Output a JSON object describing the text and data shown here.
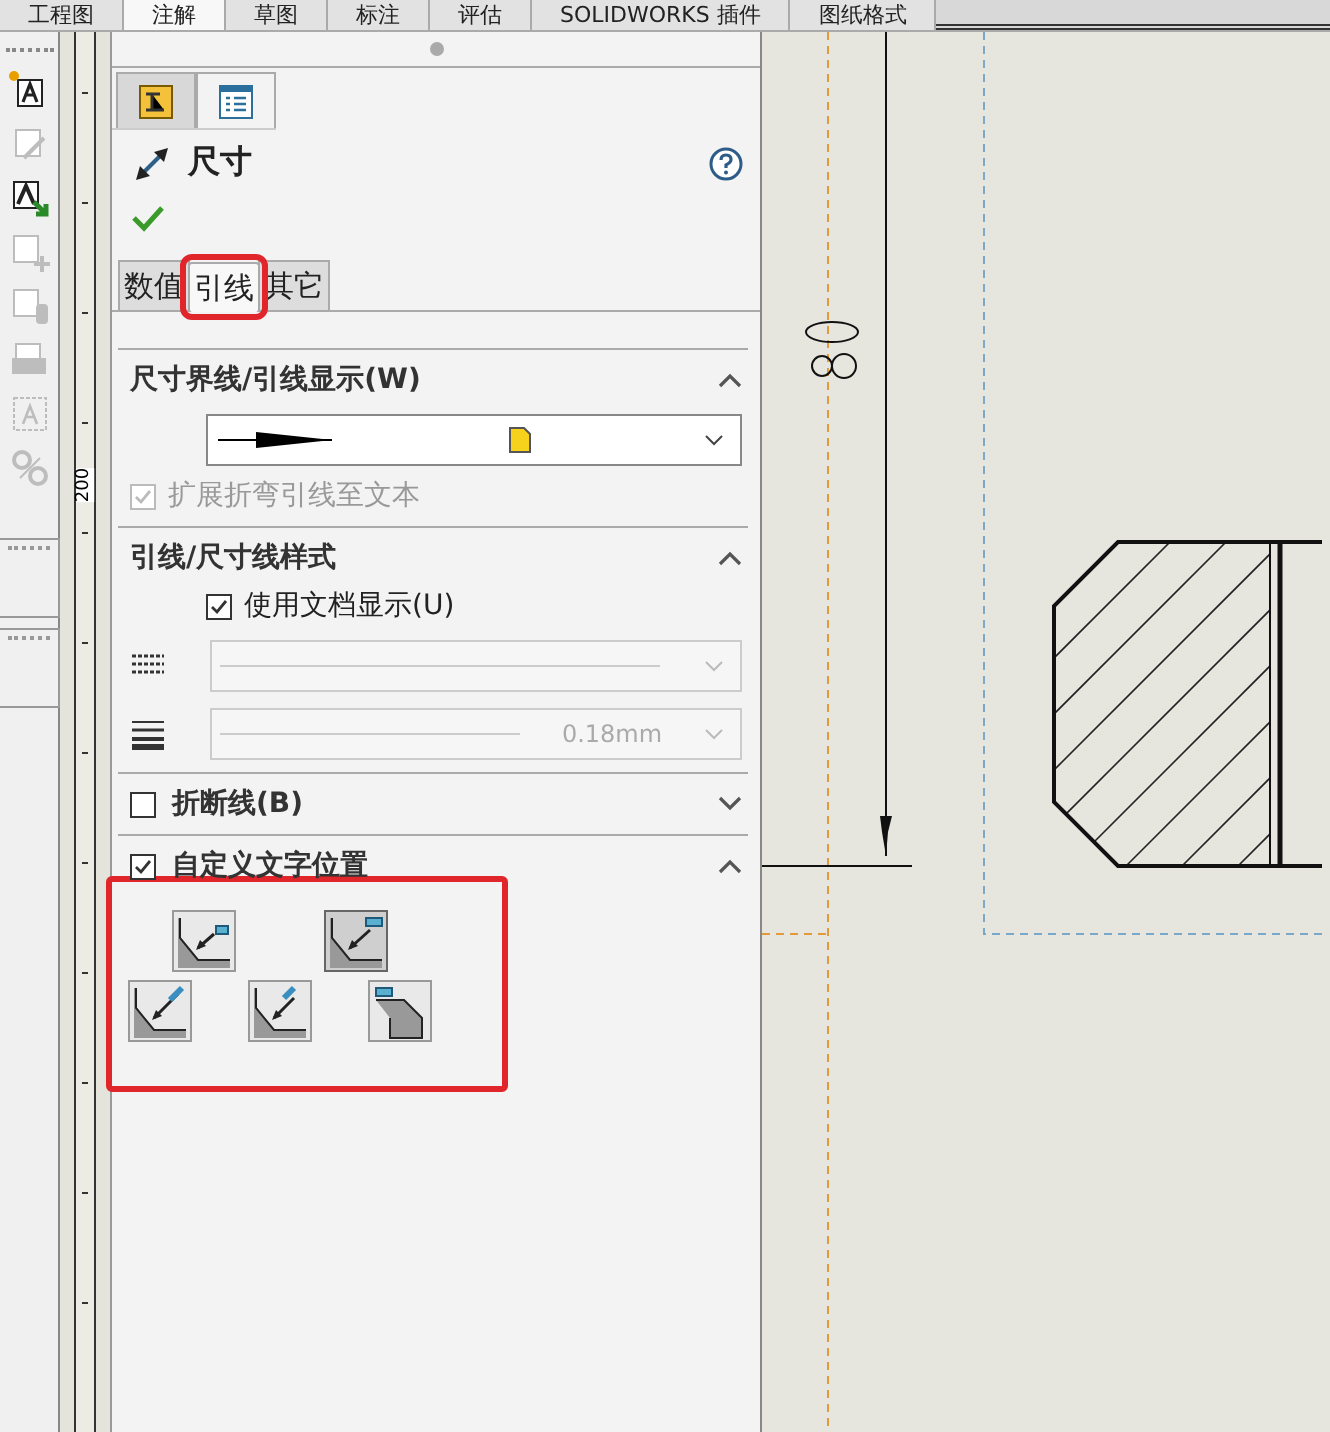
{
  "ribbon_tabs": [
    {
      "label": "工程图",
      "selected": false
    },
    {
      "label": "注解",
      "selected": true
    },
    {
      "label": "草图",
      "selected": false
    },
    {
      "label": "标注",
      "selected": false
    },
    {
      "label": "评估",
      "selected": false
    },
    {
      "label": "SOLIDWORKS 插件",
      "selected": false
    },
    {
      "label": "图纸格式",
      "selected": false
    }
  ],
  "left_toolbar": {
    "tools": [
      {
        "disabled": false
      },
      {
        "disabled": true
      },
      {
        "disabled": false
      },
      {
        "disabled": true
      },
      {
        "disabled": true
      },
      {
        "disabled": true
      },
      {
        "disabled": true
      },
      {
        "disabled": true
      }
    ]
  },
  "ruler": {
    "label": "200"
  },
  "panel": {
    "icon_tabs": [
      {
        "selected": true
      },
      {
        "selected": false
      }
    ],
    "title": "尺寸",
    "tabs": [
      {
        "label": "数值",
        "selected": false,
        "highlighted": false
      },
      {
        "label": "引线",
        "selected": true,
        "highlighted": true
      },
      {
        "label": "其它",
        "selected": false,
        "highlighted": false
      }
    ],
    "sections": [
      {
        "kind": "display",
        "title": "尺寸界线/引线显示(W)",
        "expanded": true,
        "checkbox": {
          "label": "扩展折弯引线至文本",
          "checked": true,
          "disabled": true
        }
      },
      {
        "kind": "style",
        "title": "引线/尺寸线样式",
        "expanded": true,
        "checkbox": {
          "label": "使用文档显示(U)",
          "checked": true,
          "disabled": false
        },
        "thickness": "0.18mm"
      },
      {
        "kind": "toggle",
        "title": "折断线(B)",
        "expanded": false,
        "checked": false
      },
      {
        "kind": "positions",
        "title": "自定义文字位置",
        "expanded": true,
        "checked": true,
        "highlighted": true,
        "buttons": [
          {
            "selected": false
          },
          {
            "selected": true
          },
          {
            "selected": false
          },
          {
            "selected": false
          },
          {
            "selected": false
          }
        ]
      }
    ]
  }
}
